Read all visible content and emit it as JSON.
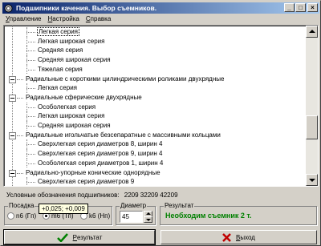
{
  "window": {
    "title": "Подшипники качения. Выбор съемников.",
    "btn_min": "_",
    "btn_max": "□",
    "btn_close": "×"
  },
  "menu": {
    "items": [
      {
        "pre": "",
        "accel": "У",
        "post": "правление"
      },
      {
        "pre": "",
        "accel": "Н",
        "post": "астройка"
      },
      {
        "pre": "",
        "accel": "С",
        "post": "правка"
      }
    ]
  },
  "tree": {
    "items": [
      {
        "text": "Легкая серия",
        "level": 2,
        "selected": true
      },
      {
        "text": "Легкая широкая серия",
        "level": 2
      },
      {
        "text": "Средняя серия",
        "level": 2
      },
      {
        "text": "Средняя широкая серия",
        "level": 2
      },
      {
        "text": "Тяжелая серия",
        "level": 2
      },
      {
        "text": "Радиальные с короткими цилиндрическими роликами двухрядные",
        "level": 1,
        "expander": true
      },
      {
        "text": "Легкая серия",
        "level": 2
      },
      {
        "text": "Радиальные сферические двухрядные",
        "level": 1,
        "expander": true
      },
      {
        "text": "Особолегкая серия",
        "level": 2
      },
      {
        "text": "Легкая широкая серия",
        "level": 2
      },
      {
        "text": "Средняя широкая серия",
        "level": 2
      },
      {
        "text": "Радиальные игольчатые безсепаратные с массивными кольцами",
        "level": 1,
        "expander": true
      },
      {
        "text": "Сверхлегкая серия диаметров 8, ширин 4",
        "level": 2
      },
      {
        "text": "Сверхлегкая серия диаметров 9, ширин 4",
        "level": 2
      },
      {
        "text": "Особолегкая серия диаметров 1, ширин 4",
        "level": 2
      },
      {
        "text": "Радиально-упорные конические однорядные",
        "level": 1,
        "expander": true
      },
      {
        "text": "Сверхлегкая серия диаметров 9",
        "level": 2
      }
    ]
  },
  "codes": {
    "label": "Условные обозначения подшипников:",
    "values": "2209  32209  42209"
  },
  "posadka": {
    "title": "Посадка",
    "options": [
      {
        "label": "n6 (Гп)",
        "checked": false
      },
      {
        "label": "m6 (Тп)",
        "checked": true
      },
      {
        "label": "k6 (Нп)",
        "checked": false
      }
    ]
  },
  "diameter": {
    "title": "Диаметр",
    "value": "45"
  },
  "result": {
    "title": "Результат",
    "text": "Необходим съемник 2 т."
  },
  "tooltip": {
    "text": "+0,025; +0,009"
  },
  "buttons": {
    "result_accel": "Р",
    "result_rest": "езультат",
    "exit_accel": "В",
    "exit_rest": "ыход"
  }
}
